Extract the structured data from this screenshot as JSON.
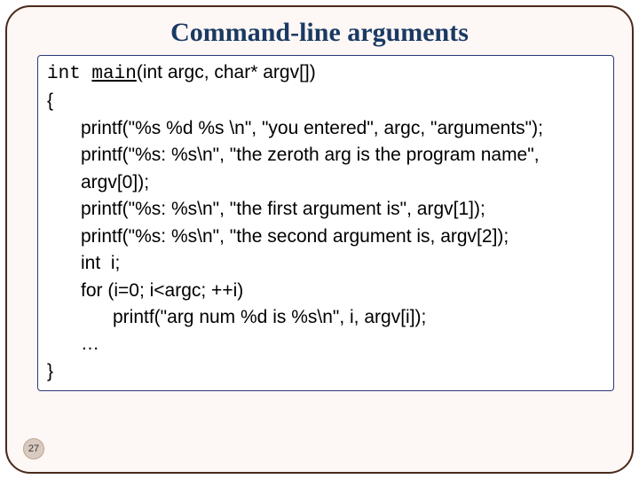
{
  "title": "Command-line arguments",
  "code": {
    "l1a": "int ",
    "l1b": "main",
    "l1c": "(int argc, char* argv[])",
    "l2": "{",
    "l3": "printf(\"%s %d %s \\n\", \"you entered\", argc, \"arguments\");",
    "l4": "printf(\"%s: %s\\n\", \"the zeroth arg is the program name\",",
    "l5": "argv[0]);",
    "l6": "printf(\"%s: %s\\n\", \"the first argument is\", argv[1]);",
    "l7": "printf(\"%s: %s\\n\", \"the second argument is, argv[2]);",
    "l8": "int  i;",
    "l9": "for (i=0; i<argc; ++i)",
    "l10": "printf(\"arg num %d is %s\\n\", i, argv[i]);",
    "l11": "…",
    "l12": "}"
  },
  "page_number": "27"
}
